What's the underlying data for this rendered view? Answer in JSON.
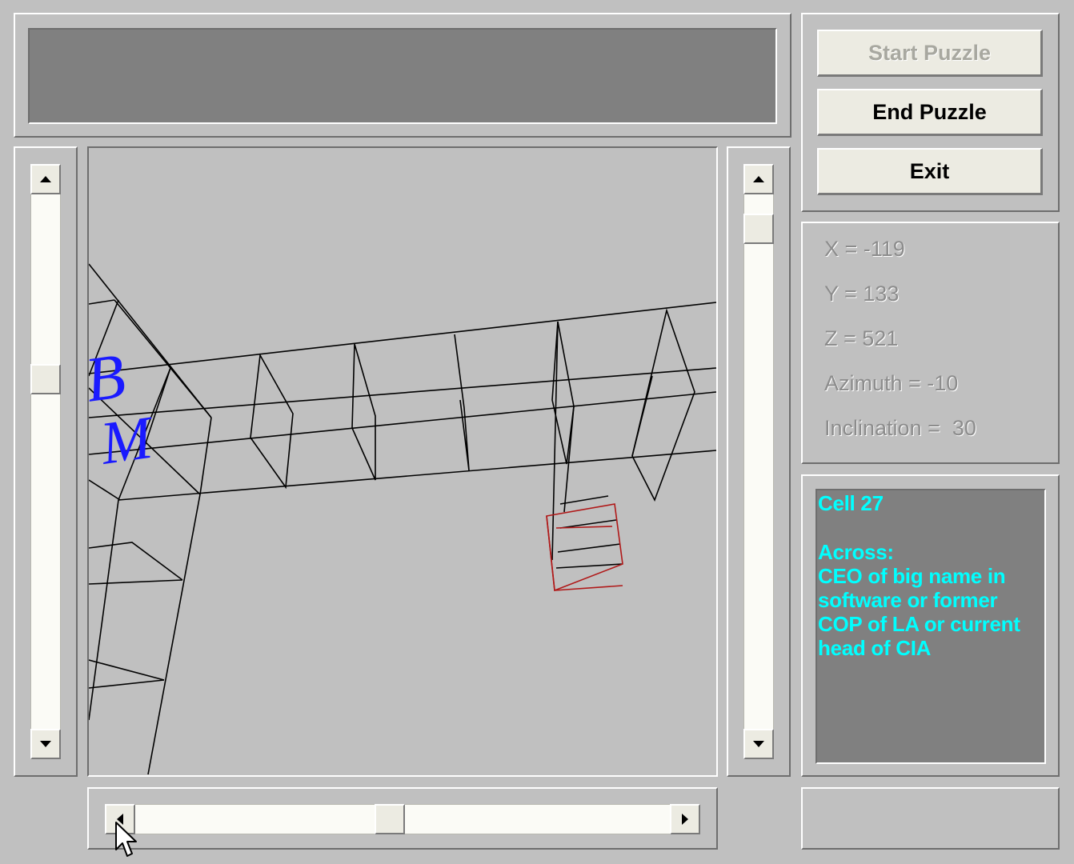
{
  "buttons": {
    "start": "Start Puzzle",
    "end": "End Puzzle",
    "exit": "Exit"
  },
  "coords": {
    "x": "X = -119",
    "y": "Y = 133",
    "z": "Z = 521",
    "azimuth": "Azimuth = -10",
    "inclination": "Inclination =  30"
  },
  "clue": {
    "cell": "Cell 27",
    "direction": "Across:",
    "lines": [
      "CEO of big name in",
      "software or former",
      "COP of LA or current",
      "head of CIA"
    ]
  },
  "viewport": {
    "letters": [
      "B",
      "M"
    ]
  },
  "colors": {
    "wireframe": "#000000",
    "selected_cell": "#b01818",
    "letters": "#1a1aff",
    "clue_text": "#00ffff",
    "clue_bg": "#808080"
  }
}
